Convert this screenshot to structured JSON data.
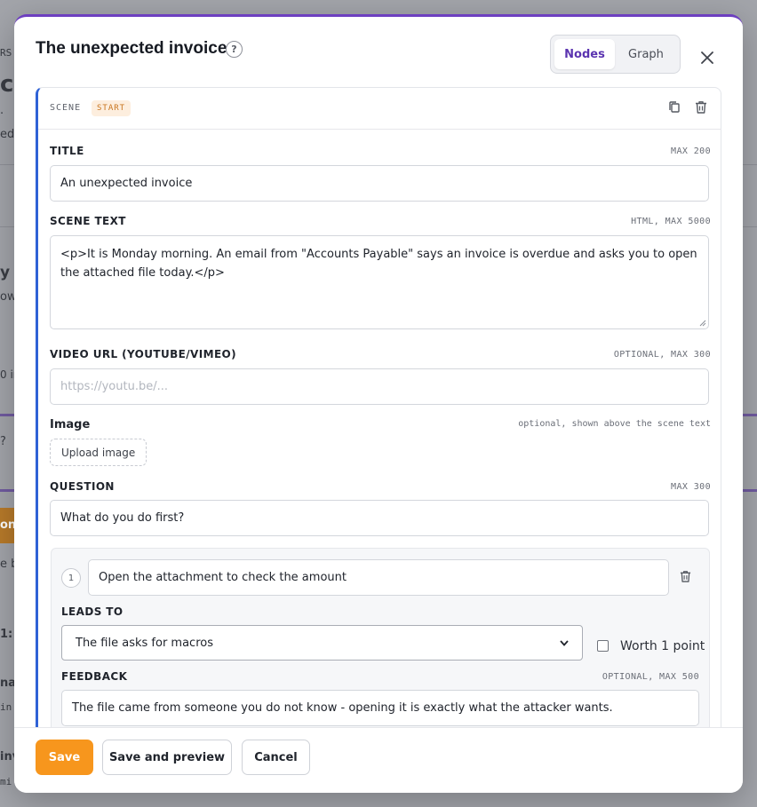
{
  "background": {
    "fragments": [
      "RS",
      "ce",
      ".",
      "ed",
      "y h",
      "owr",
      "0 in",
      "?",
      "on",
      "e br",
      "1: F",
      "nai",
      "in",
      "inv",
      "mi"
    ]
  },
  "modal": {
    "title": "The unexpected invoice",
    "help_glyph": "?",
    "tabs": [
      {
        "label": "Nodes",
        "active": true
      },
      {
        "label": "Graph",
        "active": false
      }
    ],
    "close_glyph": "×"
  },
  "scene": {
    "section_label": "SCENE",
    "badge": "START",
    "title_field": {
      "label": "TITLE",
      "hint": "MAX 200",
      "value": "An unexpected invoice"
    },
    "text_field": {
      "label": "SCENE TEXT",
      "hint": "HTML, MAX 5000",
      "value": "<p>It is Monday morning. An email from \"Accounts Payable\" says an invoice is overdue and asks you to open the attached file today.</p>"
    },
    "video_field": {
      "label": "VIDEO URL (YOUTUBE/VIMEO)",
      "hint": "OPTIONAL, MAX 300",
      "placeholder": "https://youtu.be/..."
    },
    "image_field": {
      "label": "Image",
      "hint": "optional, shown above the scene text",
      "button": "Upload image"
    },
    "question_field": {
      "label": "QUESTION",
      "hint": "MAX 300",
      "value": "What do you do first?"
    },
    "options": [
      {
        "number": "1",
        "text": "Open the attachment to check the amount",
        "leads_to_label": "LEADS TO",
        "leads_to_value": "The file asks for macros",
        "worth_label": "Worth 1 point",
        "feedback_label": "FEEDBACK",
        "feedback_hint": "OPTIONAL, MAX 500",
        "feedback_value": "The file came from someone you do not know - opening it is exactly what the attacker wants."
      }
    ]
  },
  "footer": {
    "save": "Save",
    "save_preview": "Save and preview",
    "cancel": "Cancel"
  },
  "colors": {
    "accent_purple": "#6d3fc0",
    "scene_border": "#2f62d6",
    "save_orange": "#f7961d",
    "badge_bg": "#fdeede",
    "badge_text": "#c8741e"
  }
}
